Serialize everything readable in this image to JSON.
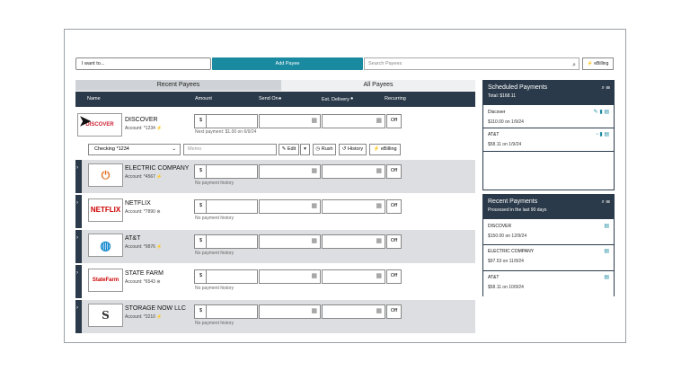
{
  "toolbar": {
    "i_want_to": "I want to...",
    "add_payee": "Add Payee",
    "search_placeholder": "Search Payees",
    "ebilling": "eBilling"
  },
  "tabs": {
    "recent": "Recent Payees",
    "all": "All Payees"
  },
  "table_header": {
    "name": "Name",
    "amount": "Amount",
    "send_on": "Send On",
    "est_delivery": "Est. Delivery",
    "recurring": "Recurring"
  },
  "first_payee": {
    "name": "DISCOVER",
    "logo_text": "DISCOVER",
    "account": "Account: *1234",
    "dollar": "$",
    "off": "Off",
    "history": "Next payment: $1.00 on 6/9/24",
    "checking": "Checking  *1234",
    "memo_placeholder": "Memo",
    "edit": "Edit",
    "rush": "Rush",
    "history_btn": "History",
    "ebilling": "eBilling"
  },
  "payees": [
    {
      "name": "ELECTRIC COMPANY",
      "logo_text": "ELECTRIC",
      "account": "Account: *4567",
      "history": "No payment history",
      "dollar": "$",
      "off": "Off"
    },
    {
      "name": "NETFLIX",
      "logo_text": "NETFLIX",
      "account": "Account: *7890",
      "history": "No payment history",
      "dollar": "$",
      "off": "Off"
    },
    {
      "name": "AT&T",
      "logo_text": "AT&T",
      "account": "Account: *9876",
      "history": "No payment history",
      "dollar": "$",
      "off": "Off"
    },
    {
      "name": "STATE FARM",
      "logo_text": "StateFarm",
      "account": "Account: *6543",
      "history": "No payment history",
      "dollar": "$",
      "off": "Off"
    },
    {
      "name": "STORAGE NOW LLC",
      "logo_text": "S",
      "account": "Account: *3210",
      "history": "No payment history",
      "dollar": "$",
      "off": "Off"
    }
  ],
  "scheduled": {
    "title": "Scheduled Payments",
    "total": "Total: $168.11",
    "items": [
      {
        "name": "Discover",
        "detail": "$110.00 on 1/9/24"
      },
      {
        "name": "AT&T",
        "detail": "$58.11 on 1/9/24"
      }
    ]
  },
  "recent": {
    "title": "Recent Payments",
    "subtitle": "Processed in the last 90 days",
    "items": [
      {
        "name": "DISCOVER",
        "detail": "$150.00 on 12/9/24"
      },
      {
        "name": "ELECTRIC COMPANY",
        "detail": "$97.53 on 11/9/24"
      },
      {
        "name": "AT&T",
        "detail": "$58.11 on 10/9/24"
      }
    ]
  },
  "colors": {
    "accent": "#1a8aa0",
    "header": "#2b3a4a",
    "row_alt": "#dcdee1"
  }
}
